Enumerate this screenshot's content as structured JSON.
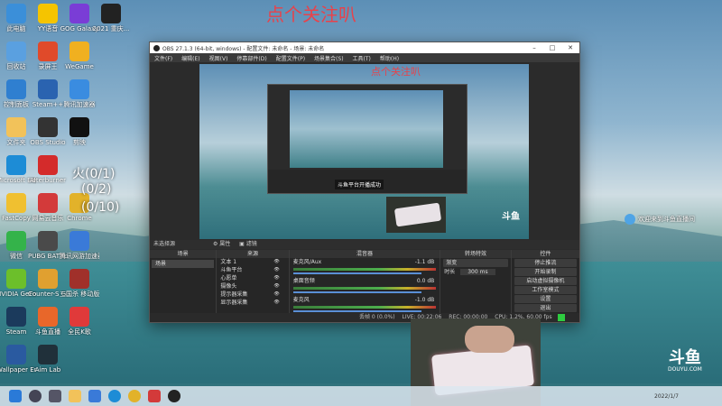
{
  "overlay": {
    "follow_text": "点个关注叭",
    "inner_follow_text": "点个关注叭",
    "counter1": "火(0/1)",
    "counter2": "(0/2)",
    "counter3": "(0/10)",
    "welcome": "欢迎来到斗鱼直播间"
  },
  "desktop_icons": [
    {
      "label": "此电脑",
      "color": "#3b8fd9"
    },
    {
      "label": "YY语音",
      "color": "#f5c400"
    },
    {
      "label": "GOG Galaxy",
      "color": "#7a3dd6"
    },
    {
      "label": "2021 重庆...",
      "color": "#222222"
    },
    {
      "label": "回收站",
      "color": "#5aa0e0"
    },
    {
      "label": "录屏王",
      "color": "#e04a2a"
    },
    {
      "label": "WeGame",
      "color": "#f0b020"
    },
    {
      "label": "控制面板",
      "color": "#2f7fd0"
    },
    {
      "label": "Steam++",
      "color": "#2a63b0"
    },
    {
      "label": "腾讯加速器",
      "color": "#3a8ce0"
    },
    {
      "label": "文件夹",
      "color": "#f2c25a"
    },
    {
      "label": "OBS Studio",
      "color": "#333333"
    },
    {
      "label": "剪映",
      "color": "#111111"
    },
    {
      "label": "Microsoft Edge",
      "color": "#1d8cd6"
    },
    {
      "label": "Afterburner",
      "color": "#d42b2b"
    },
    {
      "label": "FastCopy",
      "color": "#f0c030"
    },
    {
      "label": "网易云音乐",
      "color": "#d33a3a"
    },
    {
      "label": "Chrome",
      "color": "#e2b22a"
    },
    {
      "label": "微信",
      "color": "#34b34a"
    },
    {
      "label": "PUBG BATTLEGR...",
      "color": "#4a4a4a"
    },
    {
      "label": "腾讯网游加速器",
      "color": "#3a7ad8"
    },
    {
      "label": "NVIDIA GeForce",
      "color": "#6cbf2b"
    },
    {
      "label": "Counter-S Global Off...",
      "color": "#e0a030"
    },
    {
      "label": "三国杀 移动版",
      "color": "#a0302a"
    },
    {
      "label": "Steam",
      "color": "#1b3a5c"
    },
    {
      "label": "斗鱼直播",
      "color": "#e8672a"
    },
    {
      "label": "全民K歌",
      "color": "#e03a3a"
    },
    {
      "label": "Wallpaper Engine: ...",
      "color": "#2a5aa0"
    },
    {
      "label": "Aim Lab",
      "color": "#20303a"
    }
  ],
  "obs": {
    "title": "OBS 27.1.3 (64-bit, windows) - 配置文件: 未命名 - 场景: 未命名",
    "menu": [
      "文件(F)",
      "编辑(E)",
      "视图(V)",
      "停靠部件(D)",
      "配置文件(P)",
      "场景集合(S)",
      "工具(T)",
      "帮助(H)"
    ],
    "scene_status": "未选择源",
    "tab_properties": "属性",
    "tab_filters": "滤镜",
    "docks": {
      "scenes": {
        "title": "场景",
        "items": [
          "场景"
        ]
      },
      "sources": {
        "title": "来源",
        "items": [
          "文本 1",
          "斗鱼平台",
          "心愿单",
          "摄像头",
          "提示器采集",
          "显示器采集"
        ]
      },
      "mixer": {
        "title": "混音器",
        "channels": [
          {
            "name": "麦克风/Aux",
            "db": "-1.1 dB"
          },
          {
            "name": "桌面音频",
            "db": "0.0 dB"
          },
          {
            "name": "麦克风",
            "db": "-1.0 dB"
          }
        ]
      },
      "transitions": {
        "title": "转场特效",
        "type": "渐变",
        "duration_label": "时长",
        "duration": "300 ms"
      },
      "controls": {
        "title": "控件",
        "buttons": [
          "停止推流",
          "开始录制",
          "启动虚拟摄像机",
          "工作室模式",
          "设置",
          "退出"
        ]
      }
    },
    "status": {
      "dropped": "丢帧 0 (0.0%)",
      "live": "LIVE: 00:22:06",
      "rec": "REC: 00:00:00",
      "cpu": "CPU: 1.2%, 60.00 fps"
    }
  },
  "preview": {
    "inner_notice": "斗鱼平台开播成功"
  },
  "brand": {
    "logo": "斗鱼",
    "sub": "DOUYU.COM"
  },
  "taskbar": {
    "time": "2022/1/7"
  }
}
